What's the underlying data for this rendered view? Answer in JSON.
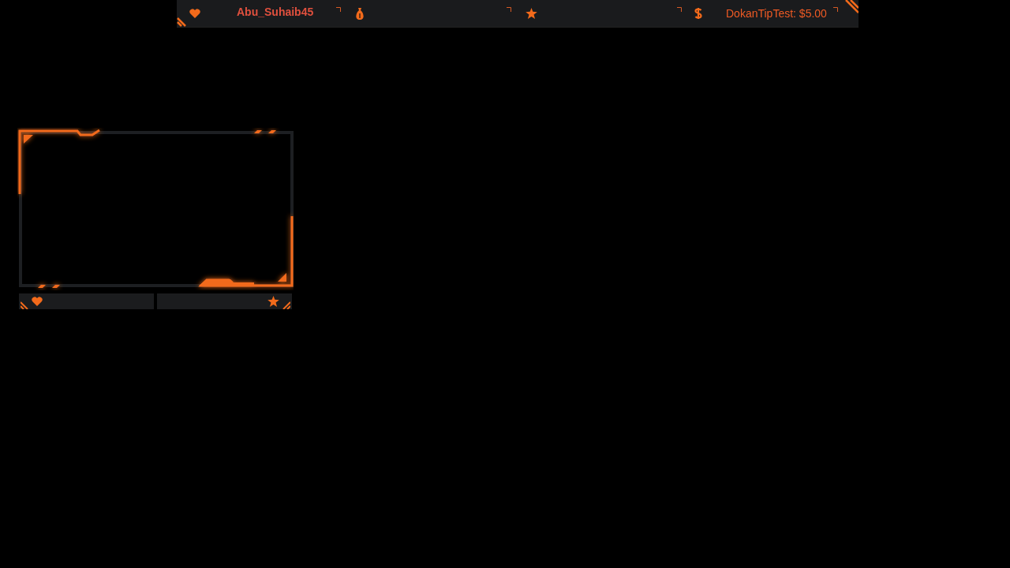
{
  "top_bar": {
    "segments": [
      {
        "kind": "heart",
        "text": "Abu_Suhaib45"
      },
      {
        "kind": "moneybag"
      },
      {
        "kind": "star"
      },
      {
        "kind": "dollar",
        "text": "DokanTipTest: $5.00"
      }
    ]
  },
  "webcam_frame": {
    "bottom_bar": {
      "segments": [
        {
          "kind": "heart"
        },
        {
          "kind": "star"
        }
      ]
    }
  }
}
